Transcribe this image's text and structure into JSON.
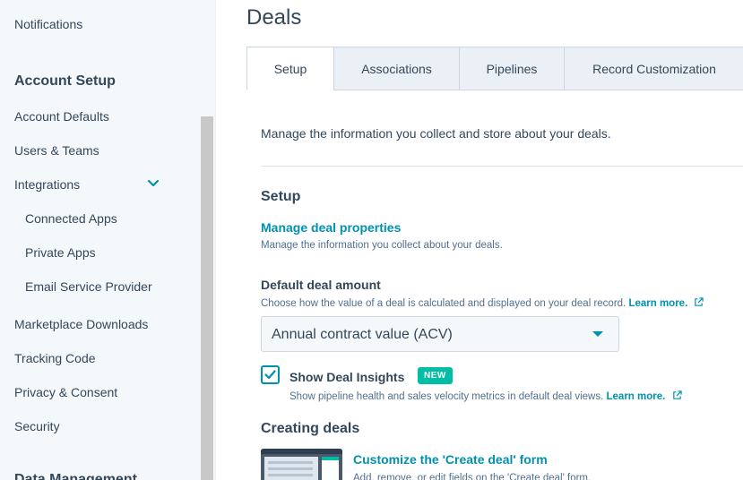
{
  "sidebar": {
    "notifications": "Notifications",
    "account_setup_heading": "Account Setup",
    "items": {
      "account_defaults": "Account Defaults",
      "users_teams": "Users & Teams",
      "integrations": "Integrations",
      "connected_apps": "Connected Apps",
      "private_apps": "Private Apps",
      "email_service_provider": "Email Service Provider",
      "marketplace_downloads": "Marketplace Downloads",
      "tracking_code": "Tracking Code",
      "privacy_consent": "Privacy & Consent",
      "security": "Security"
    },
    "next_heading_partial": "Data Management"
  },
  "main": {
    "title": "Deals",
    "tabs": [
      "Setup",
      "Associations",
      "Pipelines",
      "Record Customization"
    ],
    "active_tab": "Setup",
    "intro": "Manage the information you collect and store about your deals.",
    "setup": {
      "heading": "Setup",
      "manage_link": "Manage deal properties",
      "manage_help": "Manage the information you collect about your deals.",
      "default_amount_label": "Default deal amount",
      "default_amount_help": "Choose how the value of a deal is calculated and displayed on your deal record.",
      "learn_more": "Learn more.",
      "default_amount_value": "Annual contract value (ACV)",
      "insights_label": "Show Deal Insights",
      "insights_checked": true,
      "new_badge": "NEW",
      "insights_help": "Show pipeline health and sales velocity metrics in default deal views."
    },
    "creating": {
      "heading": "Creating deals",
      "customize_link": "Customize the 'Create deal' form",
      "customize_help": "Add, remove, or edit fields on the 'Create deal' form."
    }
  },
  "colors": {
    "accent": "#0091ae",
    "badge": "#00bda5",
    "text": "#33475b",
    "sidebar_bg": "#f5f8fa"
  }
}
